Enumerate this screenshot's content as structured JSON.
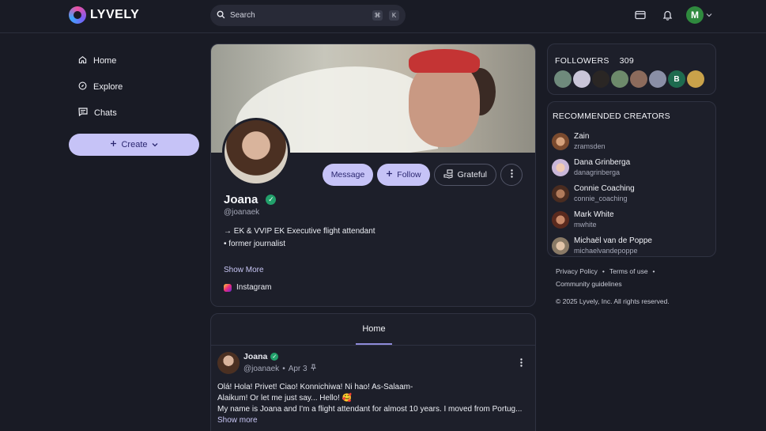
{
  "brand": {
    "name": "LYVELY"
  },
  "search": {
    "placeholder": "Search",
    "shortcut_mod": "⌘",
    "shortcut_key": "K"
  },
  "nav": {
    "items": [
      {
        "label": "Home",
        "icon": "home-icon"
      },
      {
        "label": "Explore",
        "icon": "compass-icon"
      },
      {
        "label": "Chats",
        "icon": "chat-icon"
      }
    ],
    "create_label": "Create"
  },
  "user": {
    "initial": "M"
  },
  "profile": {
    "name": "Joana",
    "handle": "@joanaek",
    "bio_line1": "→ EK & VVIP EK Executive flight attendant",
    "bio_line2": "• former journalist",
    "show_more": "Show More",
    "instagram": "Instagram",
    "actions": {
      "message": "Message",
      "follow": "Follow",
      "grateful": "Grateful"
    }
  },
  "feed": {
    "tab": "Home",
    "post": {
      "author": "Joana",
      "handle": "@joanaek",
      "date": "Apr 3",
      "line1": "Olá! Hola! Privet! Ciao! Konnichiwa! Ni hao! As-Salaam-",
      "line2": "Alaikum! Or let me just say... Hello! 🥰",
      "line3": "My name is Joana and I'm a flight attendant for almost 10 years. I moved from Portug...",
      "show_more": "Show more"
    }
  },
  "followers": {
    "title": "FOLLOWERS",
    "count": "309",
    "avatar_initial": "B"
  },
  "recommended": {
    "title": "RECOMMENDED CREATORS",
    "items": [
      {
        "name": "Zain",
        "handle": "zramsden"
      },
      {
        "name": "Dana Grinberga",
        "handle": "danagrinberga"
      },
      {
        "name": "Connie Coaching",
        "handle": "connie_coaching"
      },
      {
        "name": "Mark White",
        "handle": "mwhite"
      },
      {
        "name": "Michaël van de Poppe",
        "handle": "michaelvandepoppe"
      }
    ]
  },
  "footer": {
    "privacy": "Privacy Policy",
    "terms": "Terms of use",
    "guidelines": "Community guidelines",
    "copyright": "© 2025 Lyvely, Inc. All rights reserved."
  },
  "colors": {
    "accent": "#c6c3f7",
    "background": "#191b25",
    "verified": "#22a06b"
  }
}
